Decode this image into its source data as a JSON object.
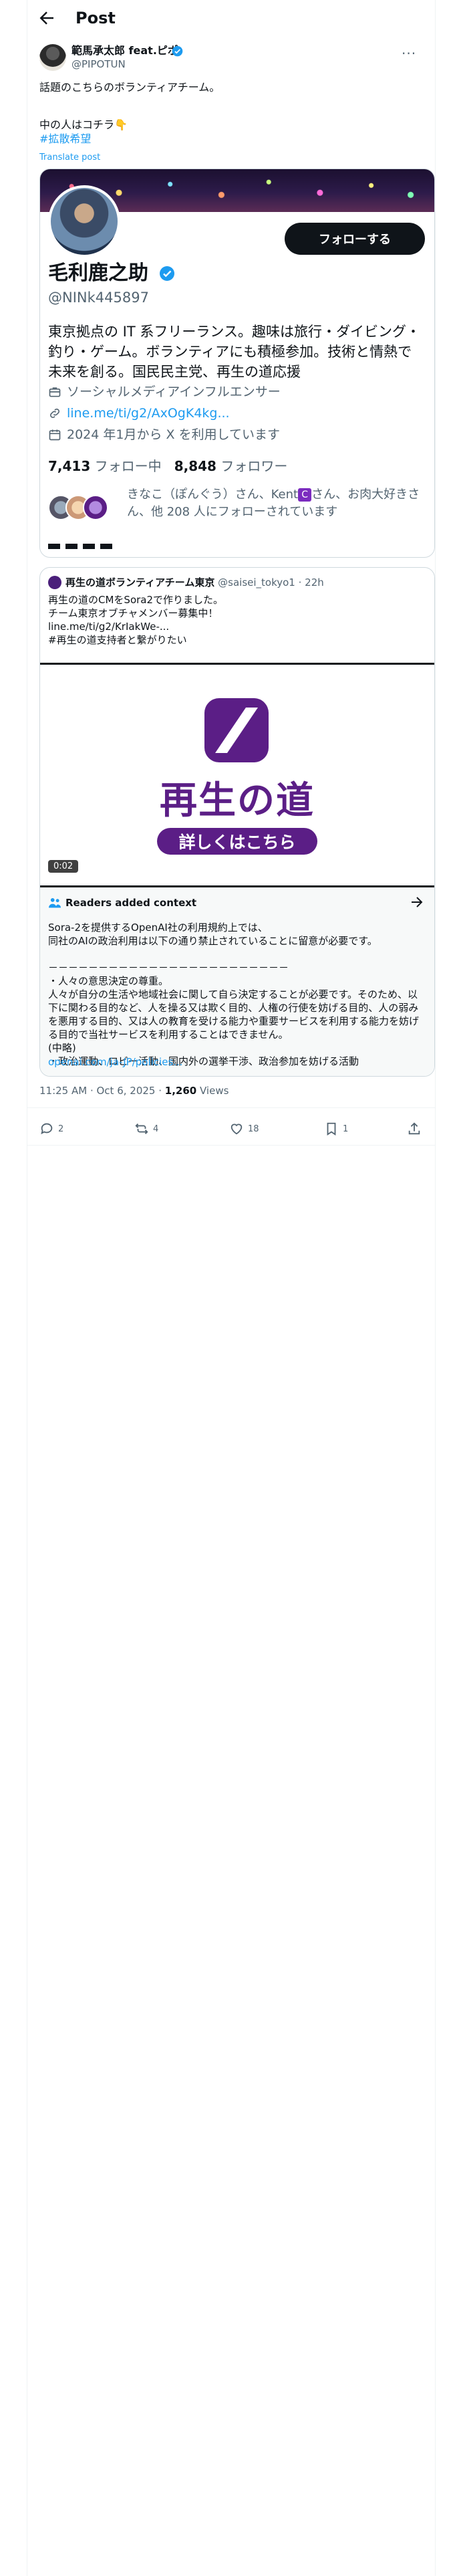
{
  "header": {
    "title": "Post"
  },
  "author": {
    "name": "範馬承太郎 feat.ピポ",
    "handle": "@PIPOTUN"
  },
  "post": {
    "line1": "話題のこちらのボランティアチーム。",
    "line2": "中の人はコチラ👇",
    "hashtag": "#拡散希望",
    "translate": "Translate post"
  },
  "profile_card": {
    "follow_label": "フォローする",
    "name": "毛利鹿之助",
    "handle": "@NINk445897",
    "bio": "東京拠点の IT 系フリーランス。趣味は旅行・ダイビング・釣り・ゲーム。ボランティアにも積極参加。技術と情熱で未来を創る。国民民主党、再生の道応援",
    "category": "ソーシャルメディアインフルエンサー",
    "link": "line.me/ti/g2/AxOgK4kg...",
    "joined": "2024 年1月から X を利用しています",
    "following_count": "7,413",
    "following_label": "フォロー中",
    "followers_count": "8,848",
    "followers_label": "フォロワー",
    "mutual_a": "きなこ（ぽんぐう）さん、Kent",
    "kent_badge": "C",
    "mutual_b": "さん、お肉大好きさん、他 208 人にフォローされています"
  },
  "quote": {
    "name": "再生の道ボランティアチーム東京",
    "handle": "@saisei_tokyo1",
    "time": "· 22h",
    "text": "再生の道のCMをSora2で作りました。\nチーム東京オブチャメンバー募集中！\nline.me/ti/g2/KrIakWe-...\n#再生の道支持者と繋がりたい",
    "media_title": "再生の道",
    "media_button": "詳しくはこちら",
    "duration": "0:02"
  },
  "note": {
    "title": "Readers added context",
    "text": "Sora-2を提供するOpenAI社の利用規約上では、\n同社のAIの政治利用は以下の通り禁止されていることに留意が必要です。\n\n－－－－－－－－－－－－－－－－－－－－－－－－\n・人々の意思決定の尊重。\n人々が自分の生活や地域社会に関して自ら決定することが必要です。そのため、以下に関わる目的など、人を操る又は欺く目的、人権の行使を妨げる目的、人の弱みを悪用する目的、又は人の教育を受ける能力や重要サービスを利用する能力を妨げる目的で当社サービスを利用することはできません。\n(中略)\n・政治運動、ロビー活動、国内外の選挙干渉、政治参加を妨げる活動",
    "link": "openai.com/ja-JP/policies..."
  },
  "meta": {
    "time": "11:25 AM · Oct 6, 2025 · ",
    "views": "1,260",
    "views_label": " Views"
  },
  "actions": {
    "replies": "2",
    "reposts": "4",
    "likes": "18",
    "bookmarks": "1"
  },
  "colors": {
    "accent": "#1d9bf0",
    "brand_purple": "#5b1e86",
    "text": "#0f1419",
    "muted": "#536471"
  }
}
